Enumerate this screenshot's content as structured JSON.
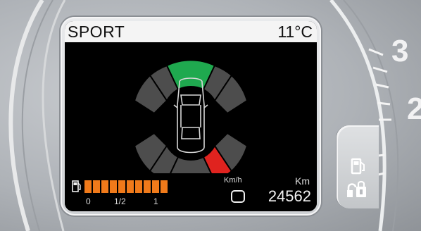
{
  "display": {
    "mode": "SPORT",
    "temperature": "11°C"
  },
  "tyres": {
    "colors": {
      "normal": "#4d4d4d",
      "ok": "#1fa94f",
      "alert": "#e0231f"
    },
    "front_center_status": "ok",
    "rear_right_status": "alert"
  },
  "fuel": {
    "level_fraction": 1.0,
    "ticks": [
      "0",
      "1/2",
      "1"
    ],
    "color": "#f07a1a"
  },
  "speed": {
    "unit": "Km/h",
    "value": "0"
  },
  "odometer": {
    "unit": "Km",
    "value": "24562"
  },
  "gauge": {
    "numbers": [
      "3",
      "2"
    ]
  },
  "side_icons": [
    "fuel-pump-icon",
    "fuel-door-lock-icon"
  ]
}
